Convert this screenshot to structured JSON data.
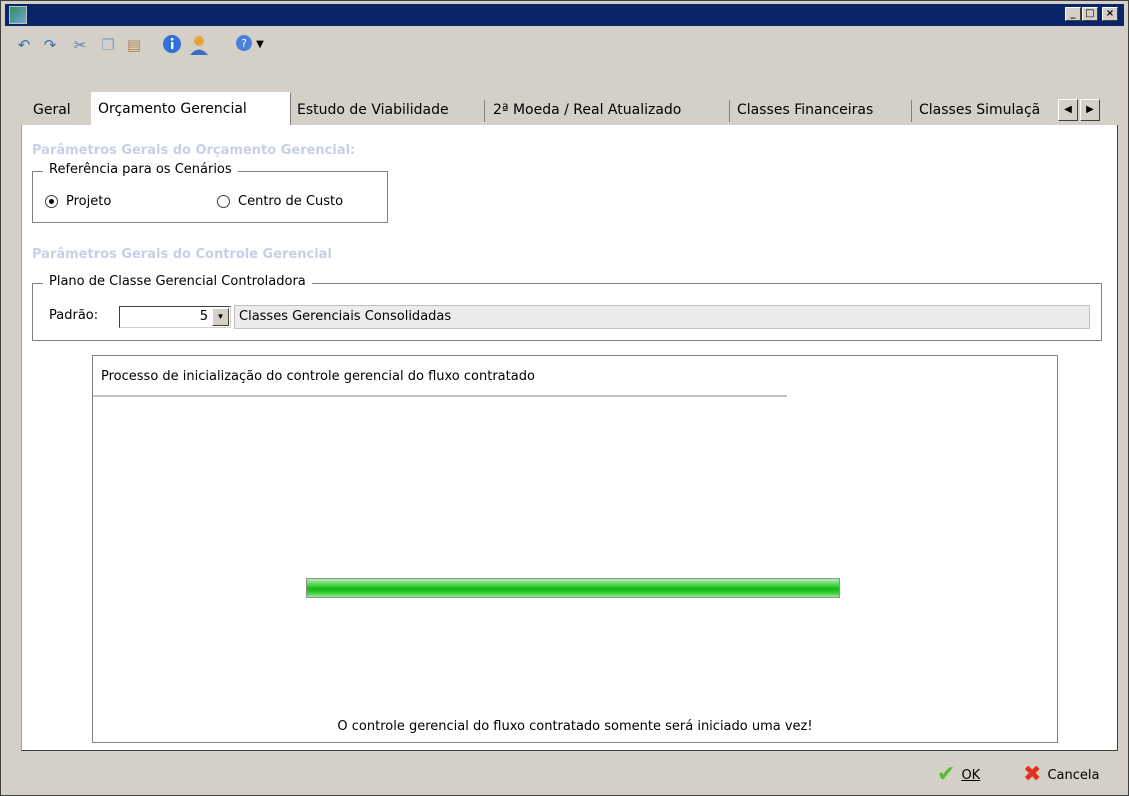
{
  "window": {
    "title": "",
    "controls": [
      "_",
      "□",
      "×"
    ]
  },
  "toolbar": {
    "icons": [
      "undo-icon",
      "redo-icon",
      "cut-icon",
      "copy-icon",
      "paste-icon",
      "info-icon",
      "user-icon",
      "help-icon"
    ]
  },
  "tabs": [
    {
      "label": "Geral"
    },
    {
      "label": "Orçamento Gerencial"
    },
    {
      "label": "Estudo de Viabilidade"
    },
    {
      "label": "2ª Moeda / Real Atualizado"
    },
    {
      "label": "Classes Financeiras"
    },
    {
      "label": "Classes Simulaçã"
    }
  ],
  "orcamento": {
    "section_title": "Parâmetros Gerais do Orçamento Gerencial:",
    "group_label": "Referência para os Cenários",
    "radio_projeto": "Projeto",
    "radio_centro": "Centro de Custo",
    "selected": "Projeto"
  },
  "controle": {
    "section_title": "Parâmetros Gerais do Controle Gerencial",
    "group_label": "Plano de Classe Gerencial Controladora",
    "padrao_label": "Padrão:",
    "padrao_value": "5",
    "padrao_description": "Classes Gerenciais Consolidadas"
  },
  "process": {
    "title": "Processo de inicialização do controle gerencial do fluxo contratado",
    "progress": 1.0,
    "footer": "O controle gerencial do fluxo contratado somente será iniciado uma vez!"
  },
  "buttons": {
    "ok": "OK",
    "cancel": "Cancela"
  },
  "colors": {
    "titlebar": "#0a246a",
    "section_title": "#c8cfe6",
    "progress": "#22c022"
  }
}
